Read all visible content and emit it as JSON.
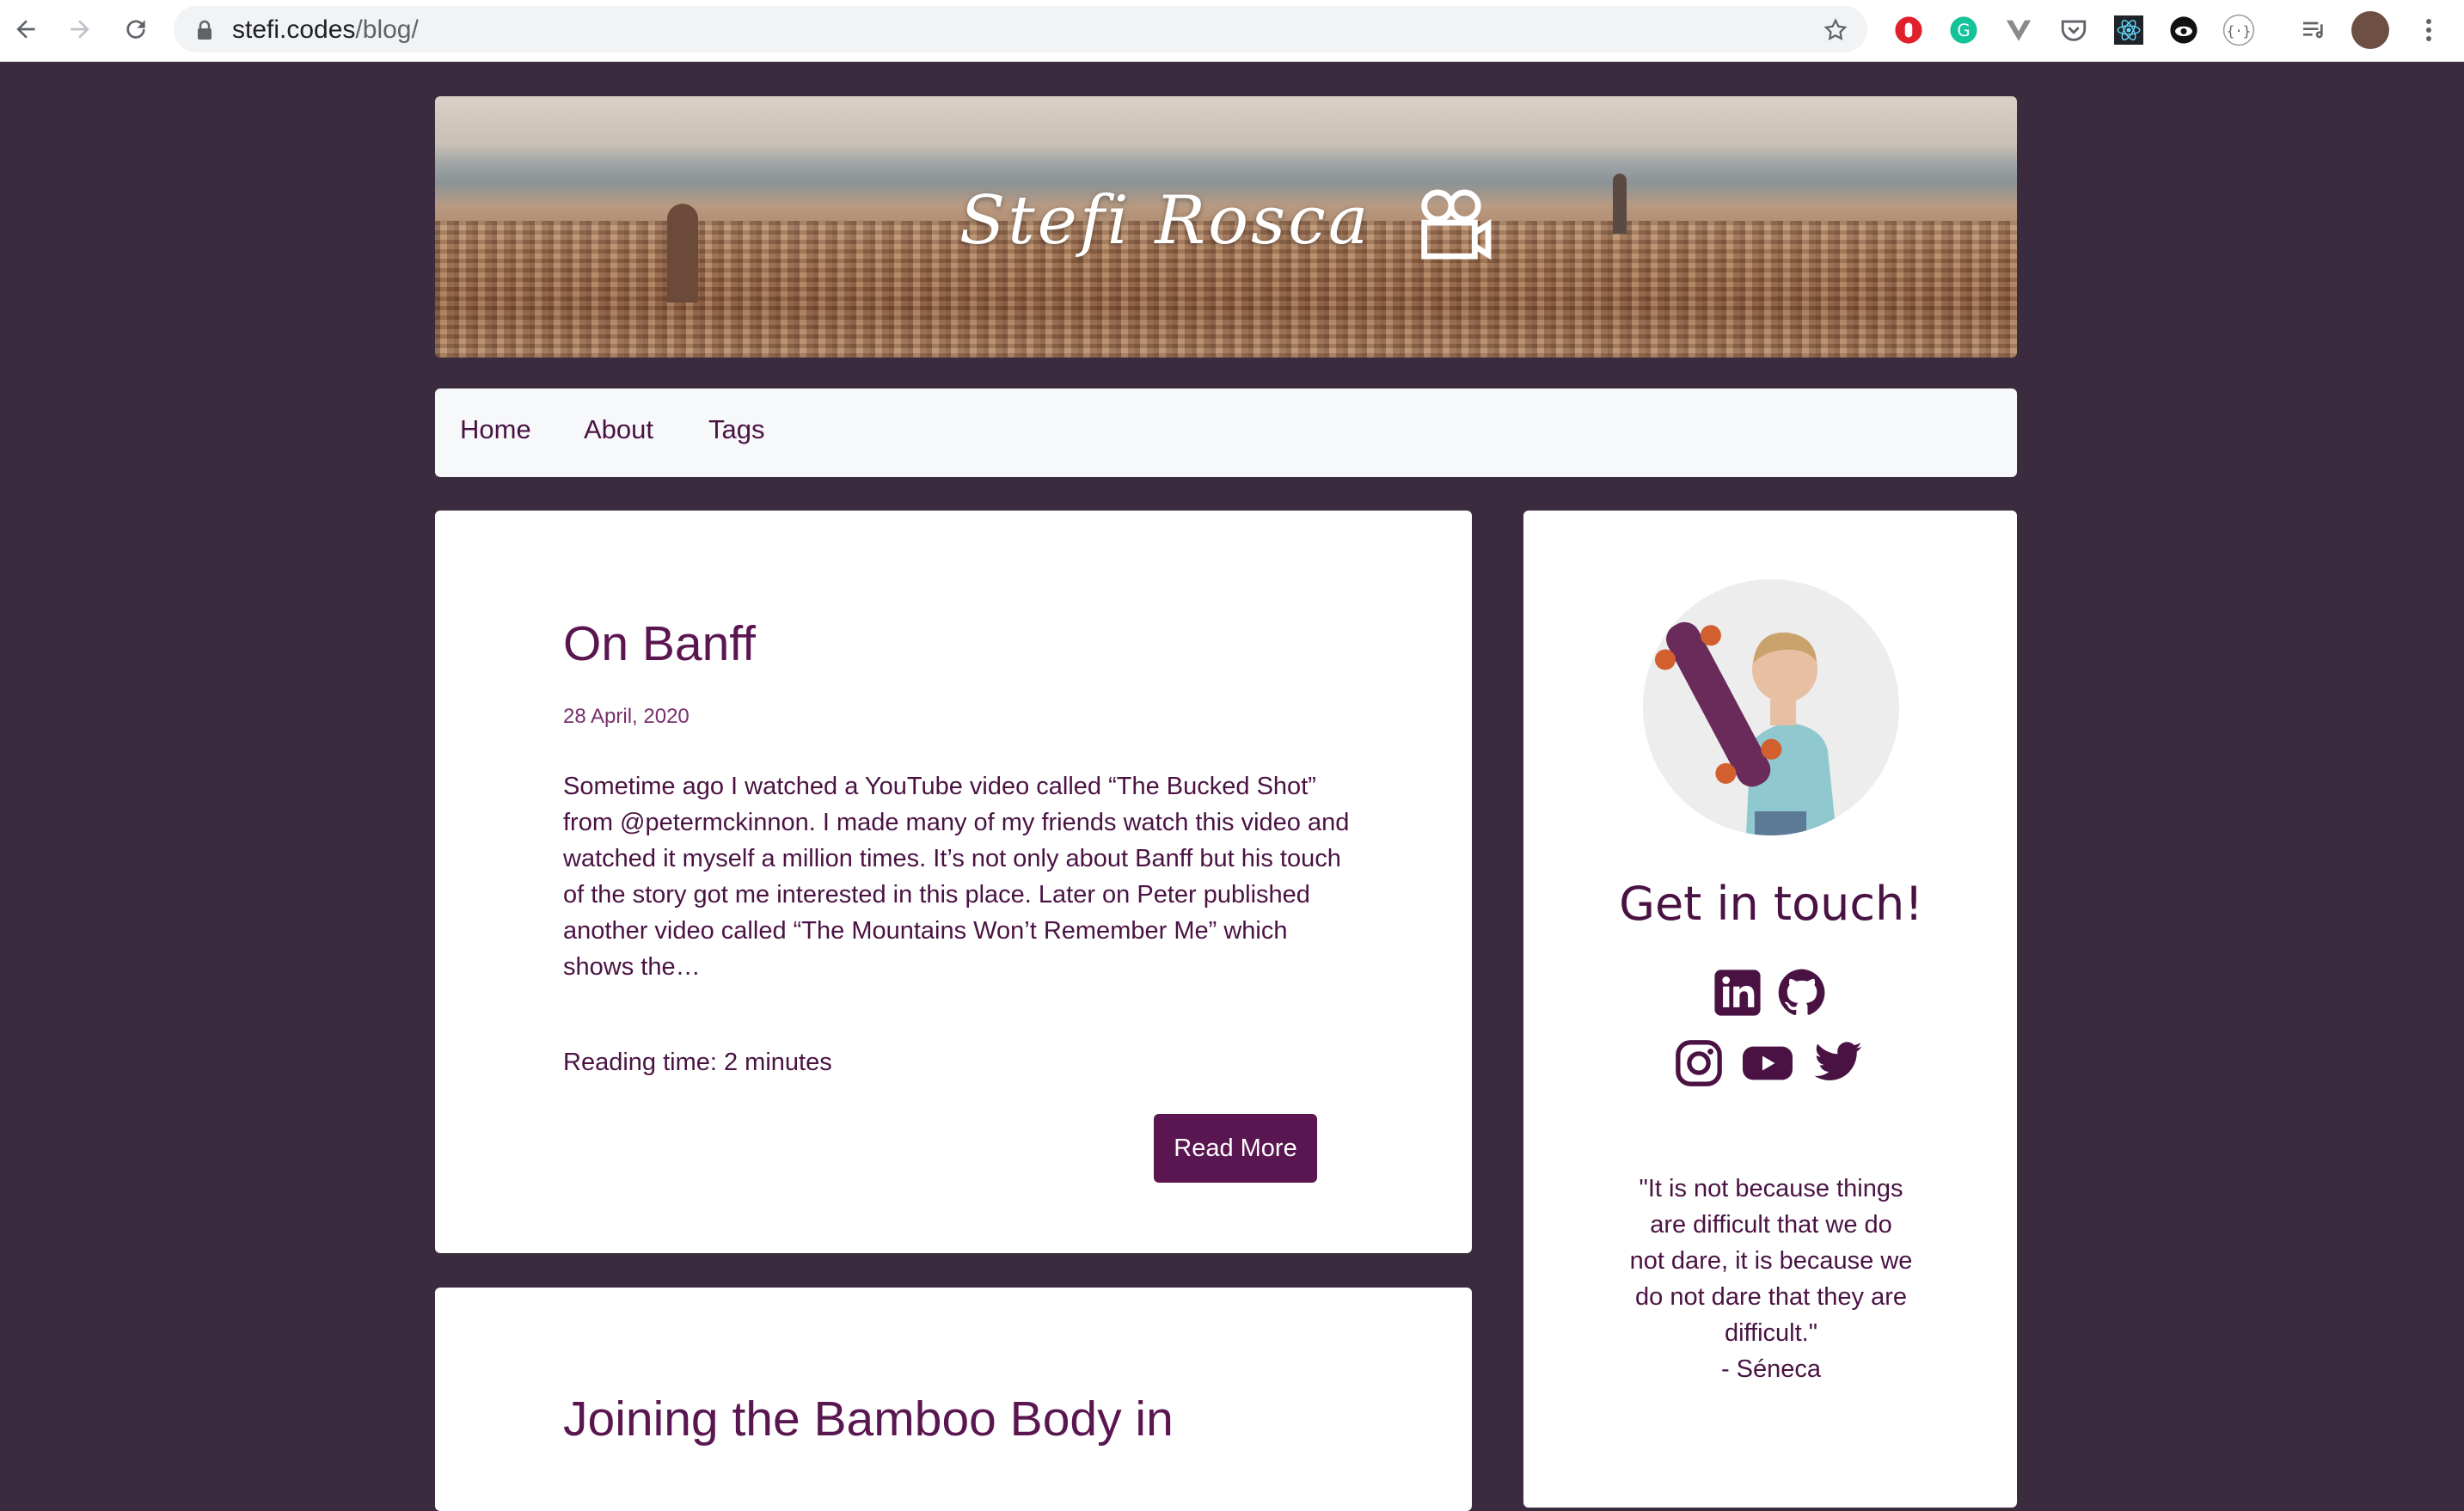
{
  "browser": {
    "url_domain": "stefi.codes",
    "url_path": "/blog/"
  },
  "banner": {
    "title": "Stefi Rosca"
  },
  "nav": {
    "items": [
      "Home",
      "About",
      "Tags"
    ]
  },
  "posts": [
    {
      "title": "On Banff",
      "date": "28 April, 2020",
      "excerpt": "Sometime ago I watched a YouTube video called “The Bucked Shot” from @petermckinnon. I made many of my friends watch this video and watched it myself a million times. It’s not only about Banff but his touch of the story got me interested in this place. Later on Peter published another video called “The Mountains Won’t Remember Me” which shows the…",
      "reading_time": "Reading time: 2 minutes",
      "read_more": "Read More"
    },
    {
      "title": "Joining the Bamboo Body in"
    }
  ],
  "sidebar": {
    "contact_title": "Get in touch!",
    "quote_lines": [
      "\"It is not because things",
      "are difficult that we do",
      "not dare, it is because we",
      "do not dare that they are",
      "difficult.\"",
      "- Séneca"
    ]
  },
  "colors": {
    "page_bg": "#3a2b3e",
    "accent": "#5a1650",
    "text": "#4a1243"
  }
}
